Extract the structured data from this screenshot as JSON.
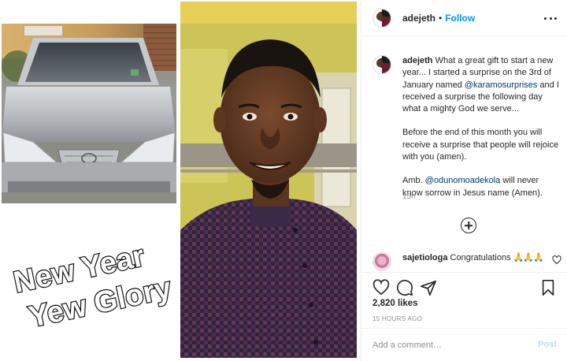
{
  "post": {
    "username": "adejeth",
    "follow_label": "Follow",
    "separator": "•"
  },
  "image": {
    "overlay_text_line1": "New Year",
    "overlay_text_line2": "Yew Glory"
  },
  "caption": {
    "username": "adejeth",
    "part1": " What a great gift to start a new year... I started a surprise on the 3rd of January named ",
    "mention1": "@karamosurprises",
    "part2": " and I received a surprise the following day what a mighty God we serve...",
    "paragraph2": "Before the end of this month you will receive a surprise that people will rejoice with you (amen).",
    "part3": "Amb. ",
    "mention2": "@odunomoadekola",
    "part4": " will never know sorrow in Jesus name (Amen).",
    "time_ago": "15h"
  },
  "comments": [
    {
      "username": "sajetiologa",
      "text": " Congratulations ",
      "emoji": "🙏🙏🙏"
    }
  ],
  "stats": {
    "likes": "2,820 likes",
    "timestamp": "15 HOURS AGO"
  },
  "comment_box": {
    "placeholder": "Add a comment…",
    "post_label": "Post"
  },
  "colors": {
    "accent": "#0095f6",
    "post_disabled": "#b2dffc",
    "muted": "#8e8e8e"
  },
  "icons": [
    "more-icon",
    "heart-icon",
    "comment-icon",
    "share-icon",
    "bookmark-icon",
    "load-more-icon"
  ]
}
